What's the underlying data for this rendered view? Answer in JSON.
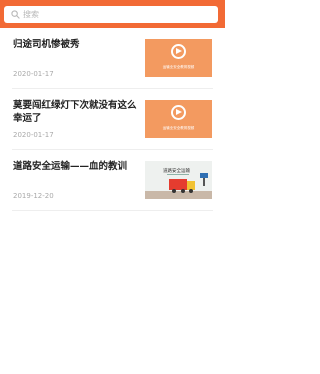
{
  "search": {
    "placeholder": "搜索",
    "icon": "search-icon"
  },
  "articles": [
    {
      "title": "归途司机惨被秀",
      "date": "2020-01-17",
      "thumbnail": {
        "type": "video",
        "caption": "运输业安全教育视频",
        "color": "#f39a60"
      }
    },
    {
      "title": "莫要闯红绿灯下次就没有这么幸运了",
      "date": "2020-01-17",
      "thumbnail": {
        "type": "video",
        "caption": "运输业安全教育视频",
        "color": "#f39a60"
      }
    },
    {
      "title": "道路安全运输——血的教训",
      "date": "2019-12-20",
      "thumbnail": {
        "type": "illustration",
        "caption": "道路安全运输"
      }
    }
  ],
  "colors": {
    "header": "#f26a35",
    "title": "#222222",
    "date": "#a9a9a9"
  }
}
